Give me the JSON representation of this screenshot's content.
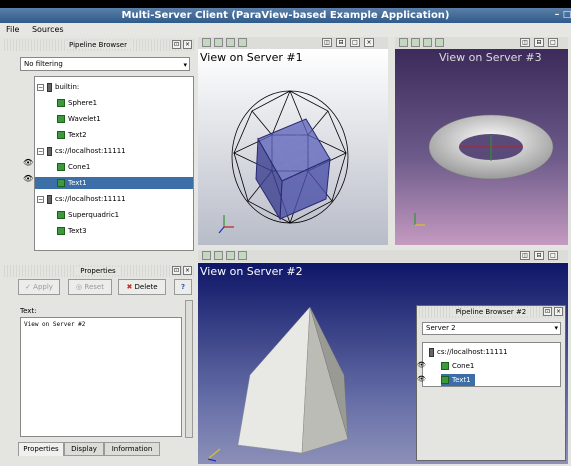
{
  "window": {
    "title": "Multi-Server Client (ParaView-based Example Application)"
  },
  "menu": [
    "File",
    "Sources"
  ],
  "pipeline_browser": {
    "title": "Pipeline Browser",
    "filter": "No filtering",
    "tree": [
      {
        "label": "builtin:",
        "kind": "server"
      },
      {
        "label": "Sphere1",
        "kind": "source"
      },
      {
        "label": "Wavelet1",
        "kind": "source"
      },
      {
        "label": "Text2",
        "kind": "source"
      },
      {
        "label": "cs://localhost:11111",
        "kind": "server"
      },
      {
        "label": "Cone1",
        "kind": "source"
      },
      {
        "label": "Text1",
        "kind": "source",
        "selected": true
      },
      {
        "label": "cs://localhost:11111",
        "kind": "server"
      },
      {
        "label": "Superquadric1",
        "kind": "source"
      },
      {
        "label": "Text3",
        "kind": "source"
      }
    ]
  },
  "properties": {
    "title": "Properties",
    "apply": "Apply",
    "reset": "Reset",
    "delete": "Delete",
    "help": "?",
    "field_label": "Text:",
    "field_value": "View on Server #2",
    "tabs": [
      "Properties",
      "Display",
      "Information"
    ]
  },
  "views": {
    "v1": {
      "title": "View on Server #1"
    },
    "v2": {
      "title": "View on Server #2"
    },
    "v3": {
      "title": "View on Server #3"
    }
  },
  "pipeline_browser_2": {
    "title": "Pipeline Browser #2",
    "server": "Server 2",
    "tree": [
      {
        "label": "cs://localhost:11111",
        "kind": "server"
      },
      {
        "label": "Cone1",
        "kind": "source"
      },
      {
        "label": "Text1",
        "kind": "source",
        "selected": true
      }
    ]
  },
  "colors": {
    "title_bar": "#2f5a8a",
    "selection": "#3c6ea8",
    "source_icon": "#3c9a3c"
  }
}
